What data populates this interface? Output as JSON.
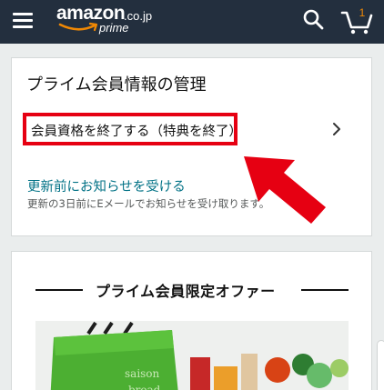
{
  "header": {
    "logo_main": "amazon",
    "logo_tld": ".co.jp",
    "logo_sub": "prime",
    "cart_count": "1",
    "icons": [
      "menu-icon",
      "search-icon",
      "cart-icon"
    ],
    "background": "#232f3e",
    "accent": "#f08804"
  },
  "membership": {
    "title": "プライム会員情報の管理",
    "cancel_label": "会員資格を終了する（特典を終了）",
    "notify_link": "更新前にお知らせを受ける",
    "notify_sub": "更新の3日前にEメールでお知らせを受け取ります。"
  },
  "offer": {
    "title": "プライム会員限定オファー",
    "bag_text_1": "saison",
    "bag_text_2": "bread"
  },
  "colors": {
    "highlight": "#e60012",
    "link": "#007185"
  }
}
